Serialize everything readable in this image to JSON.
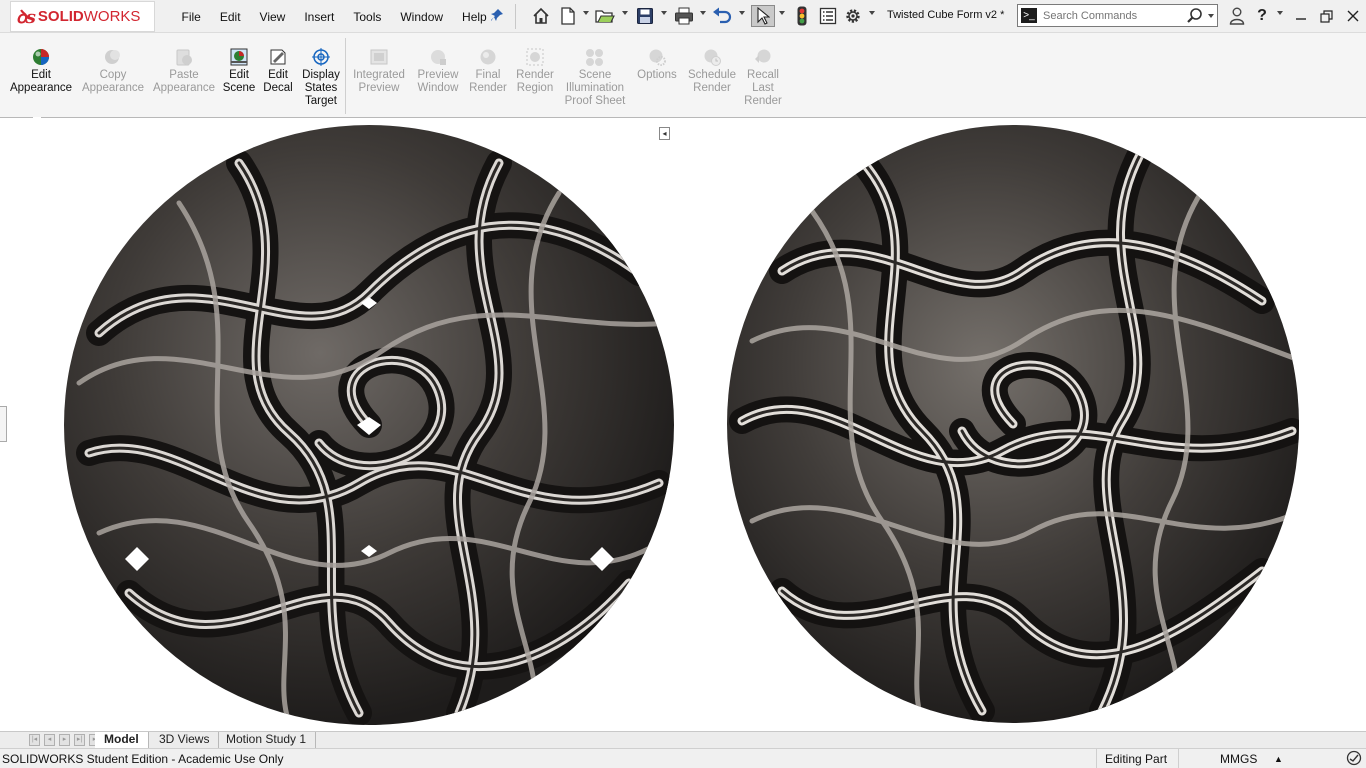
{
  "app": {
    "brand": "SOLID",
    "brand2": "WORKS"
  },
  "menu": [
    "File",
    "Edit",
    "View",
    "Insert",
    "Tools",
    "Window",
    "Help"
  ],
  "document": {
    "title": "Twisted Cube Form v2 *"
  },
  "search": {
    "placeholder": "Search Commands"
  },
  "ribbon": {
    "buttons": [
      {
        "label": "Edit\nAppearance",
        "enabled": true
      },
      {
        "label": "Copy\nAppearance",
        "enabled": false
      },
      {
        "label": "Paste\nAppearance",
        "enabled": false
      },
      {
        "label": "Edit\nScene",
        "enabled": true
      },
      {
        "label": "Edit\nDecal",
        "enabled": true
      },
      {
        "label": "Display\nStates\nTarget",
        "enabled": true
      },
      {
        "label": "Integrated\nPreview",
        "enabled": false
      },
      {
        "label": "Preview\nWindow",
        "enabled": false
      },
      {
        "label": "Final\nRender",
        "enabled": false
      },
      {
        "label": "Render\nRegion",
        "enabled": false
      },
      {
        "label": "Scene\nIllumination\nProof Sheet",
        "enabled": false
      },
      {
        "label": "Options",
        "enabled": false
      },
      {
        "label": "Schedule\nRender",
        "enabled": false
      },
      {
        "label": "Recall\nLast\nRender",
        "enabled": false
      }
    ]
  },
  "tabs": [
    {
      "label": "Model",
      "active": true
    },
    {
      "label": "3D Views",
      "active": false
    },
    {
      "label": "Motion Study 1",
      "active": false
    }
  ],
  "status": {
    "edition": "SOLIDWORKS Student Edition - Academic Use Only",
    "mode": "Editing Part",
    "units": "MMGS"
  },
  "colors": {
    "brand_red": "#d22630",
    "accent_blue": "#2a5fb0",
    "disabled_text": "#9a9a9a"
  }
}
